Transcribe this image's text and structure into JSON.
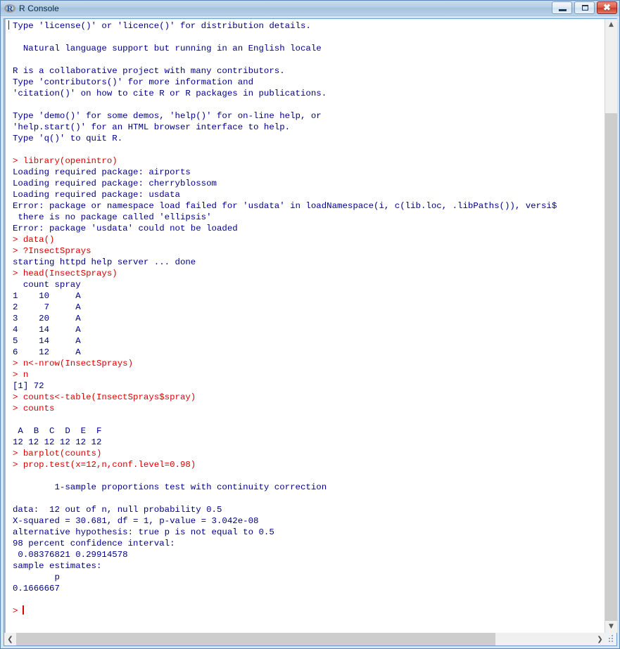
{
  "window": {
    "title": "R Console",
    "icon": "r-logo-icon",
    "icon_letter": "R",
    "controls": {
      "minimize": "minimize-button",
      "maximize": "maximize-button",
      "close": "close-button",
      "close_glyph": "✖"
    }
  },
  "colors": {
    "command_text": "#dd0000",
    "output_text": "#00008b",
    "console_bg": "#ffffff",
    "titlebar": "#a5c3de",
    "frame_border": "#6d9ccd"
  },
  "scrollbars": {
    "vertical": {
      "up_arrow": "▲",
      "down_arrow": "▼",
      "thumb_top_pct": 14,
      "thumb_height_pct": 86
    },
    "horizontal": {
      "left_arrow": "❮",
      "right_arrow": "❯",
      "thumb_left_pct": 0,
      "thumb_width_pct": 83
    },
    "resize_grip": "resize-grip"
  },
  "console": {
    "prompt": ">",
    "lines": [
      {
        "t": "Type 'license()' or 'licence()' for distribution details.",
        "k": "out"
      },
      {
        "t": "",
        "k": "out"
      },
      {
        "t": "  Natural language support but running in an English locale",
        "k": "out"
      },
      {
        "t": "",
        "k": "out"
      },
      {
        "t": "R is a collaborative project with many contributors.",
        "k": "out"
      },
      {
        "t": "Type 'contributors()' for more information and",
        "k": "out"
      },
      {
        "t": "'citation()' on how to cite R or R packages in publications.",
        "k": "out"
      },
      {
        "t": "",
        "k": "out"
      },
      {
        "t": "Type 'demo()' for some demos, 'help()' for on-line help, or",
        "k": "out"
      },
      {
        "t": "'help.start()' for an HTML browser interface to help.",
        "k": "out"
      },
      {
        "t": "Type 'q()' to quit R.",
        "k": "out"
      },
      {
        "t": "",
        "k": "out"
      },
      {
        "t": "> library(openintro)",
        "k": "cmd"
      },
      {
        "t": "Loading required package: airports",
        "k": "out"
      },
      {
        "t": "Loading required package: cherryblossom",
        "k": "out"
      },
      {
        "t": "Loading required package: usdata",
        "k": "out"
      },
      {
        "t": "Error: package or namespace load failed for 'usdata' in loadNamespace(i, c(lib.loc, .libPaths()), versi$",
        "k": "out"
      },
      {
        "t": " there is no package called 'ellipsis'",
        "k": "out"
      },
      {
        "t": "Error: package 'usdata' could not be loaded",
        "k": "out"
      },
      {
        "t": "> data()",
        "k": "cmd"
      },
      {
        "t": "> ?InsectSprays",
        "k": "cmd"
      },
      {
        "t": "starting httpd help server ... done",
        "k": "out"
      },
      {
        "t": "> head(InsectSprays)",
        "k": "cmd"
      },
      {
        "t": "  count spray",
        "k": "out"
      },
      {
        "t": "1    10     A",
        "k": "out"
      },
      {
        "t": "2     7     A",
        "k": "out"
      },
      {
        "t": "3    20     A",
        "k": "out"
      },
      {
        "t": "4    14     A",
        "k": "out"
      },
      {
        "t": "5    14     A",
        "k": "out"
      },
      {
        "t": "6    12     A",
        "k": "out"
      },
      {
        "t": "> n<-nrow(InsectSprays)",
        "k": "cmd"
      },
      {
        "t": "> n",
        "k": "cmd"
      },
      {
        "t": "[1] 72",
        "k": "out"
      },
      {
        "t": "> counts<-table(InsectSprays$spray)",
        "k": "cmd"
      },
      {
        "t": "> counts",
        "k": "cmd"
      },
      {
        "t": "",
        "k": "out"
      },
      {
        "t": " A  B  C  D  E  F ",
        "k": "out"
      },
      {
        "t": "12 12 12 12 12 12 ",
        "k": "out"
      },
      {
        "t": "> barplot(counts)",
        "k": "cmd"
      },
      {
        "t": "> prop.test(x=12,n,conf.level=0.98)",
        "k": "cmd"
      },
      {
        "t": "",
        "k": "out"
      },
      {
        "t": "        1-sample proportions test with continuity correction",
        "k": "out"
      },
      {
        "t": "",
        "k": "out"
      },
      {
        "t": "data:  12 out of n, null probability 0.5",
        "k": "out"
      },
      {
        "t": "X-squared = 30.681, df = 1, p-value = 3.042e-08",
        "k": "out"
      },
      {
        "t": "alternative hypothesis: true p is not equal to 0.5",
        "k": "out"
      },
      {
        "t": "98 percent confidence interval:",
        "k": "out"
      },
      {
        "t": " 0.08376821 0.29914578",
        "k": "out"
      },
      {
        "t": "sample estimates:",
        "k": "out"
      },
      {
        "t": "        p ",
        "k": "out"
      },
      {
        "t": "0.1666667 ",
        "k": "out"
      },
      {
        "t": "",
        "k": "out"
      },
      {
        "t": ">",
        "k": "cmd",
        "cursor": true
      }
    ]
  }
}
